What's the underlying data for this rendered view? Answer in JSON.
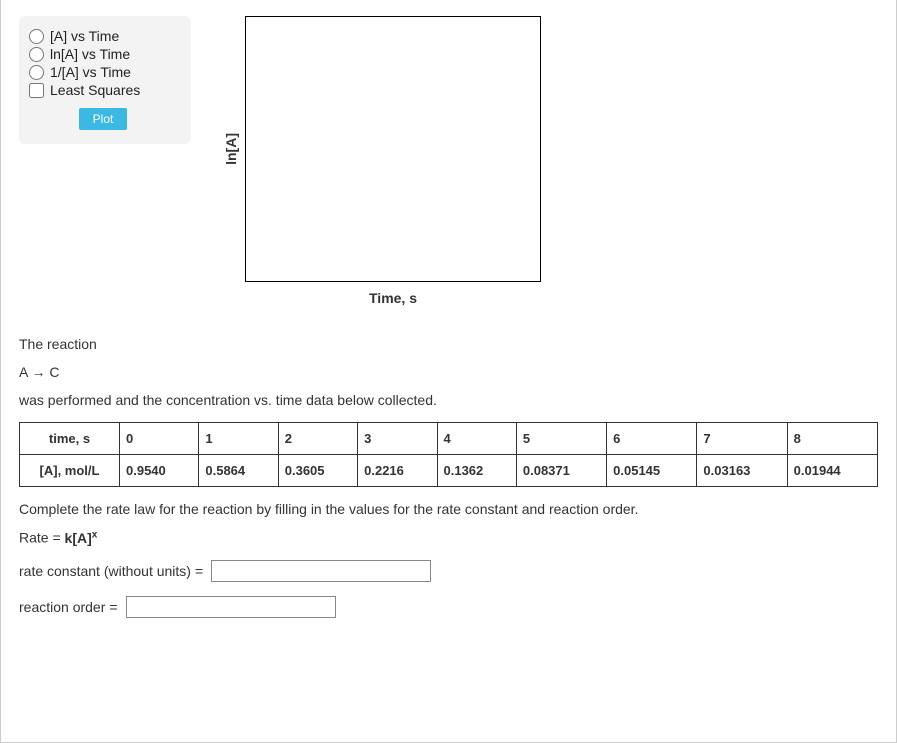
{
  "controls": {
    "options": [
      {
        "label": "[A] vs Time",
        "type": "radio"
      },
      {
        "label": "ln[A] vs Time",
        "type": "radio"
      },
      {
        "label": "1/[A] vs Time",
        "type": "radio"
      },
      {
        "label": "Least Squares",
        "type": "checkbox"
      }
    ],
    "plot_button": "Plot"
  },
  "chart": {
    "ylabel": "ln[A]",
    "xlabel": "Time, s"
  },
  "problem": {
    "intro1": "The reaction",
    "reaction": "A → C",
    "intro2": "was performed and the concentration vs. time data below collected.",
    "table": {
      "row1_header": "time, s",
      "row2_header": "[A], mol/L",
      "times": [
        "0",
        "1",
        "2",
        "3",
        "4",
        "5",
        "6",
        "7",
        "8"
      ],
      "concs": [
        "0.9540",
        "0.5864",
        "0.3605",
        "0.2216",
        "0.1362",
        "0.08371",
        "0.05145",
        "0.03163",
        "0.01944"
      ]
    },
    "instruction": "Complete the rate law for the reaction by filling in the values for the rate constant and reaction order.",
    "rate_law_prefix": "Rate = ",
    "rate_law_k": "k[A]",
    "rate_law_sup": "x",
    "rate_constant_label": "rate constant (without units)",
    "reaction_order_label": "reaction order",
    "equals": "="
  },
  "chart_data": {
    "type": "scatter",
    "title": "",
    "xlabel": "Time, s",
    "ylabel": "ln[A]",
    "x": [],
    "y": [],
    "note": "empty plot area"
  }
}
